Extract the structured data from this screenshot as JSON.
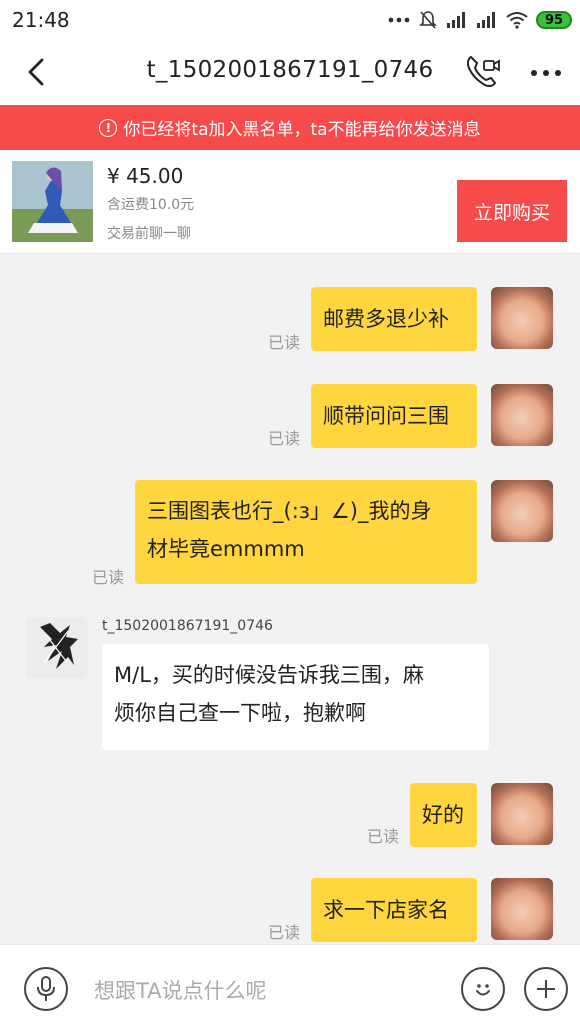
{
  "status_bar": {
    "time": "21:48",
    "battery": "95",
    "icons": [
      "dots-icon",
      "bell-muted-icon",
      "signal-icon",
      "signal-icon",
      "wifi-icon",
      "battery-icon"
    ]
  },
  "header": {
    "title": "t_1502001867191_0746"
  },
  "banner": {
    "text": "你已经将ta加入黑名单，ta不能再给你发送消息"
  },
  "product": {
    "price": "¥ 45.00",
    "shipping": "含运费10.0元",
    "chat_hint": "交易前聊一聊",
    "buy_label": "立即购买"
  },
  "messages": [
    {
      "from": "me",
      "lines": [
        "邮费多退少补"
      ],
      "status": "已读"
    },
    {
      "from": "me",
      "lines": [
        "顺带问问三围"
      ],
      "status": "已读"
    },
    {
      "from": "me",
      "lines": [
        "三围图表也行_(:з」∠)_我的身",
        "材毕竟emmmm"
      ],
      "status": "已读"
    },
    {
      "from": "them",
      "sender": "t_1502001867191_0746",
      "lines": [
        "M/L，买的时候没告诉我三围，麻",
        "烦你自己查一下啦，抱歉啊"
      ]
    },
    {
      "from": "me",
      "lines": [
        "好的"
      ],
      "status": "已读"
    },
    {
      "from": "me",
      "lines": [
        "求一下店家名"
      ],
      "status": "已读"
    }
  ],
  "input": {
    "placeholder": "想跟TA说点什么呢"
  },
  "colors": {
    "accent_red": "#f74b4b",
    "my_bubble": "#ffd63f",
    "background": "#f2f2f4"
  }
}
